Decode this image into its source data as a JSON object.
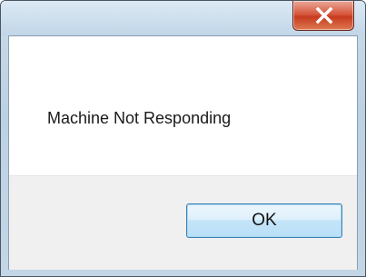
{
  "dialog": {
    "message": "Machine Not Responding",
    "ok_label": "OK",
    "close_icon": "close-x-icon"
  },
  "colors": {
    "close_button": "#c73b1f",
    "ok_button_border": "#3c7fb1",
    "button_area": "#f0f0f0"
  }
}
